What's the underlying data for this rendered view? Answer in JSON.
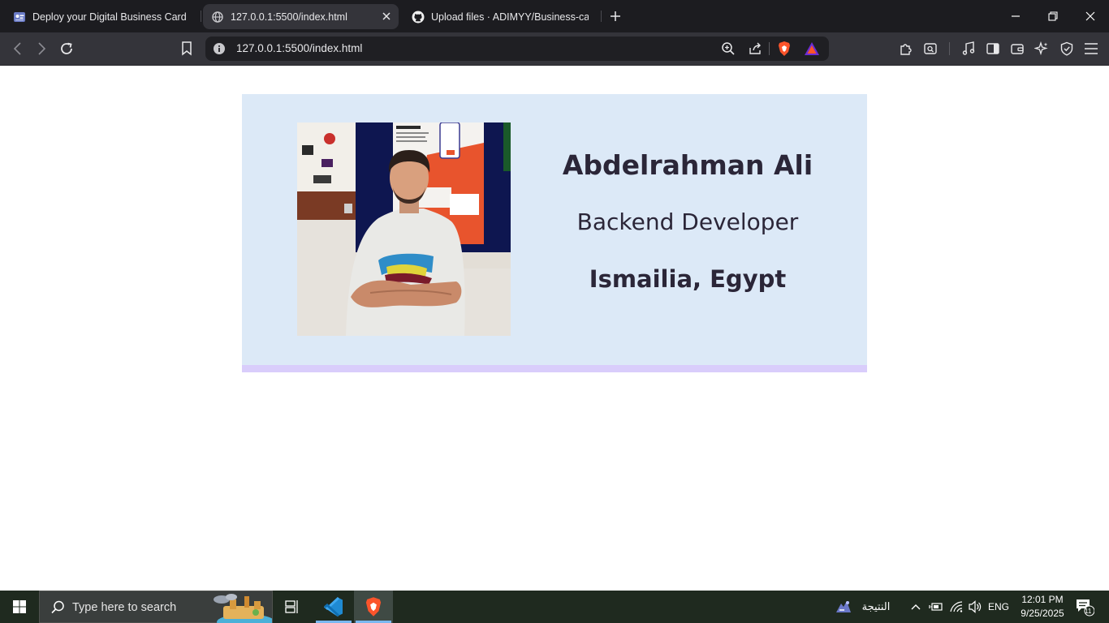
{
  "browser": {
    "tabs": [
      {
        "title": "Deploy your Digital Business Card",
        "icon": "business-card-favicon"
      },
      {
        "title": "127.0.0.1:5500/index.html",
        "icon": "globe-icon",
        "active": true
      },
      {
        "title": "Upload files · ADIMYY/Business-card",
        "icon": "github-icon"
      }
    ],
    "address": "127.0.0.1:5500/index.html"
  },
  "card": {
    "name": "Abdelrahman Ali",
    "role": "Backend Developer",
    "location": "Ismailia, Egypt",
    "photo_alt": "Profile photo of Abdelrahman Ali"
  },
  "taskbar": {
    "search_placeholder": "Type here to search",
    "weather_label": "النتيجة",
    "language": "ENG",
    "time": "12:01 PM",
    "date": "9/25/2025",
    "notification_count": "11"
  },
  "colors": {
    "card_bg": "#dce9f7",
    "card_border": "#d9cdfb",
    "text": "#2b2638",
    "tabstrip": "#1c1c20",
    "toolbar": "#34343a"
  }
}
